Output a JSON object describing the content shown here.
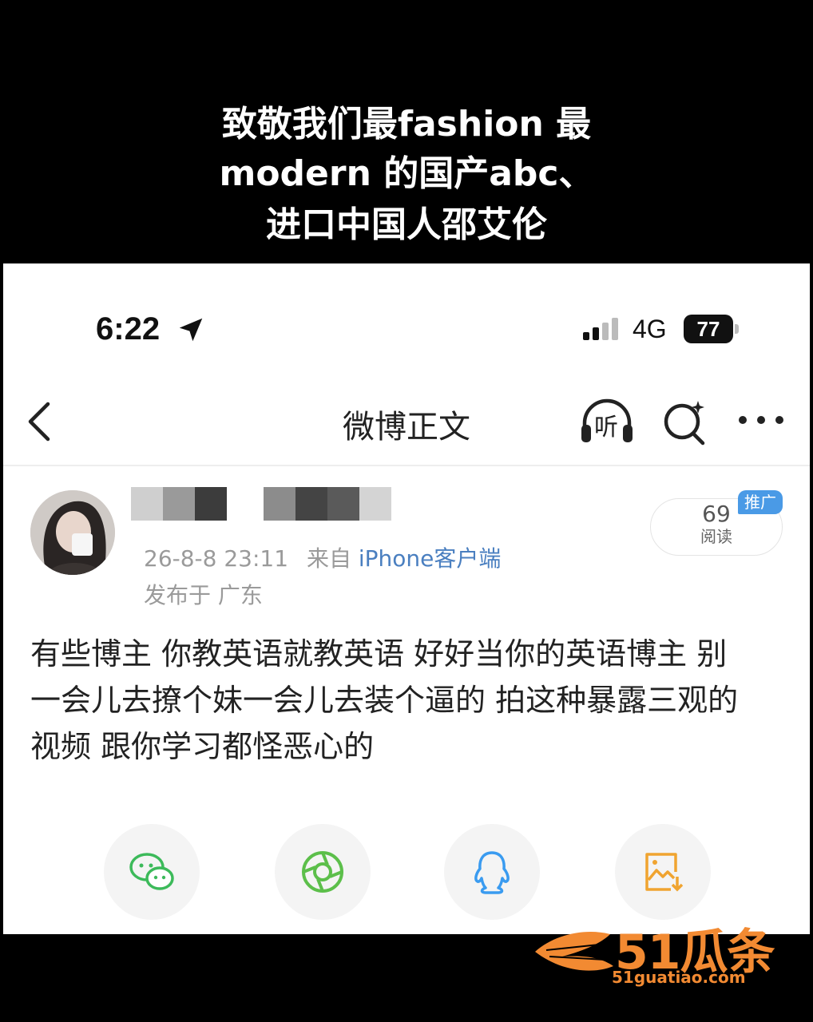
{
  "caption": {
    "line1": "致敬我们最fashion 最",
    "line2": "modern 的国产abc、",
    "line3": "进口中国人邵艾伦"
  },
  "status_bar": {
    "time": "6:22",
    "network": "4G",
    "battery": "77"
  },
  "nav": {
    "title": "微博正文",
    "listen_label": "听"
  },
  "post": {
    "date": "26-8-8 23:11",
    "from_label": "来自",
    "source": "iPhone客户端",
    "location": "发布于 广东",
    "reads_count": "69",
    "reads_label": "阅读",
    "promo_badge": "推广",
    "body_line1": "有些博主 你教英语就教英语 好好当你的英语博主 别",
    "body_line2": "一会儿去撩个妹一会儿去装个逼的 拍这种暴露三观的",
    "body_line3": "视频 跟你学习都怪恶心的"
  },
  "share": {
    "icons": [
      "wechat-icon",
      "moments-icon",
      "qq-icon",
      "save-image-icon"
    ],
    "colors": {
      "wechat": "#3cba5a",
      "moments": "#5cbf4a",
      "qq": "#3a9bf0",
      "save": "#f0a430"
    }
  },
  "watermark": {
    "text": "51瓜条",
    "url": "51guatiao.com"
  }
}
